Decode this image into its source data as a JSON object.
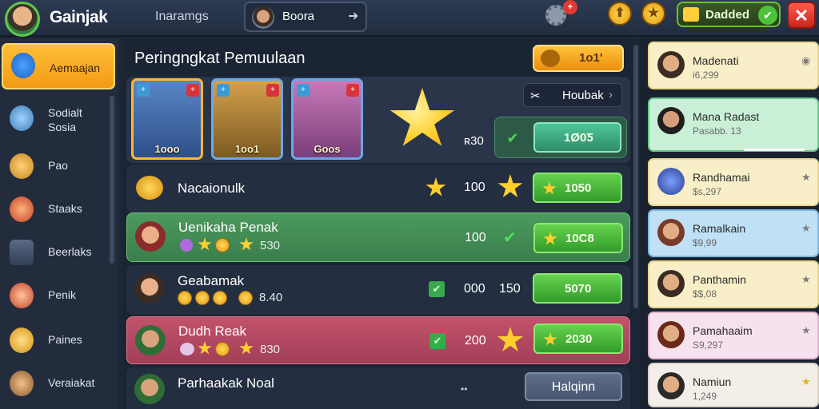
{
  "topbar": {
    "title": "Gainjak",
    "tab": "Inaramgs",
    "player": {
      "name": "Boora",
      "arrow": "➜"
    },
    "gear_badge": "+",
    "round_btn_1": "⬆",
    "round_btn_2": "★",
    "currency": {
      "label": "Dadded",
      "check": "✔"
    },
    "close": "✕"
  },
  "sidebar": {
    "items": [
      {
        "label": "Aemaajan",
        "active": true
      },
      {
        "label": "Sodialt Sosia"
      },
      {
        "label": "Pao"
      },
      {
        "label": "Staaks"
      },
      {
        "label": "Beerlaks"
      },
      {
        "label": "Penik"
      },
      {
        "label": "Paines"
      },
      {
        "label": "Veraiakat"
      }
    ]
  },
  "main": {
    "title": "Peringngkat Pemuulaan",
    "gold_btn_label": "1o1'",
    "hero": {
      "cards": [
        {
          "badge_l": "+",
          "badge": "+",
          "value": "1ooo"
        },
        {
          "badge_l": "+",
          "badge": "+",
          "value": "1oo1"
        },
        {
          "badge_l": "+",
          "badge": "+",
          "value": "Goos"
        }
      ],
      "button_label": "Houbak",
      "button_arrow": "›",
      "score": "ʀ30",
      "green_btn": "1Ø0Ƽ",
      "check": "✔"
    },
    "rows": [
      {
        "title": "Nacaionulk",
        "value": "100",
        "button": "1050"
      },
      {
        "title": "Uenikaha Penak",
        "sub": "530",
        "value": "100",
        "check": "✔",
        "button": "10C8"
      },
      {
        "title": "Geabamak",
        "sub": "8.40",
        "value": "000",
        "value2": "150",
        "button": "5070"
      },
      {
        "title": "Dudh Reak",
        "sub": "830",
        "value": "200",
        "button": "2030"
      },
      {
        "title": "Parhaakak Noal",
        "dots": "••",
        "button": "Halqinn"
      }
    ]
  },
  "right": {
    "cards": [
      {
        "name": "Madenati",
        "sub": "i6,299",
        "icon": "◉"
      },
      {
        "name": "Mana Radast",
        "sub": "Pasabb. 13",
        "icon": ""
      },
      {
        "name": "Randhamai",
        "sub": "$s,297",
        "icon": "★"
      },
      {
        "name": "Ramalkain",
        "sub": "$9,99",
        "icon": "★"
      },
      {
        "name": "Panthamin",
        "sub": "$$,08",
        "icon": "★"
      },
      {
        "name": "Pamahaaim",
        "sub": "S9,297",
        "icon": "★"
      },
      {
        "name": "Namiun",
        "sub": "1,249",
        "icon": "★"
      }
    ]
  },
  "colors": {
    "accent_gold": "#f39b14",
    "accent_green": "#4cc23a",
    "row_green": "#3f8a4e",
    "row_red": "#b8485f",
    "close_red": "#e03a32"
  }
}
